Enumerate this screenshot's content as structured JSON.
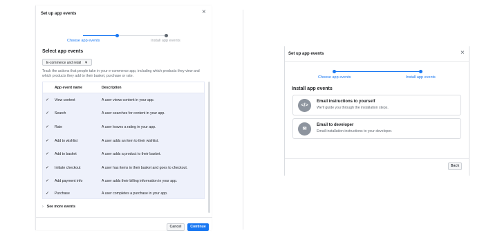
{
  "left_dialog": {
    "title": "Set up app events",
    "close": "×",
    "steps": [
      "Choose app events",
      "Install app events"
    ],
    "section_title": "Select app events",
    "dropdown_value": "E-commerce and retail",
    "description": "Track the actions that people take in your e-commerce app, including which products they view and which products they add to their basket, purchase or rate.",
    "table": {
      "headers": [
        "App event name",
        "Description"
      ],
      "rows": [
        {
          "name": "View content",
          "desc": "A user views content in your app."
        },
        {
          "name": "Search",
          "desc": "A user searches for content in your app."
        },
        {
          "name": "Rate",
          "desc": "A user leaves a rating in your app."
        },
        {
          "name": "Add to wishlist",
          "desc": "A user adds an item to their wishlist."
        },
        {
          "name": "Add to basket",
          "desc": "A user adds a product to their basket."
        },
        {
          "name": "Initiate checkout",
          "desc": "A user has items in their basket and goes to checkout."
        },
        {
          "name": "Add payment info",
          "desc": "A user adds their billing information in your app."
        },
        {
          "name": "Purchase",
          "desc": "A user completes a purchase in your app."
        }
      ]
    },
    "see_more": "See more events",
    "cancel": "Cancel",
    "continue": "Continue"
  },
  "right_dialog": {
    "title": "Set up app events",
    "close": "×",
    "steps": [
      "Choose app events",
      "Install app events"
    ],
    "section_title": "Install app events",
    "options": [
      {
        "icon": "</>",
        "title": "Email instructions to yourself",
        "desc": "We'll guide you through the installation steps."
      },
      {
        "icon": "✉",
        "title": "Email to developer",
        "desc": "Email installation instructions to your developer."
      }
    ],
    "back": "Back"
  },
  "colors": {
    "accent": "#1877f2",
    "table_bg": "#eef1fb",
    "icon_bg": "#8d949e"
  }
}
